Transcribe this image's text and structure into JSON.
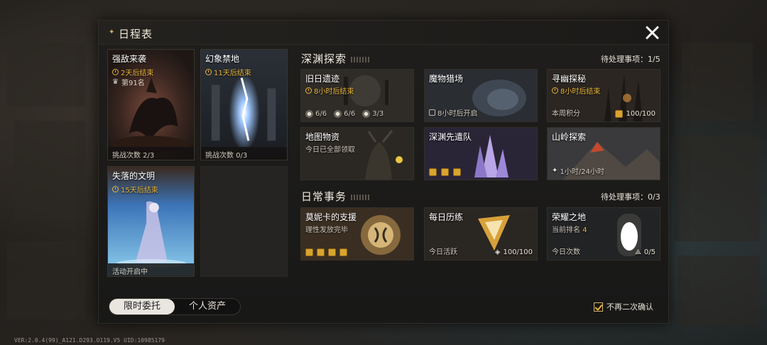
{
  "window": {
    "title": "日程表"
  },
  "left_cards": [
    {
      "title": "强敌来袭",
      "timer": "2天后结束",
      "rank": "第91名",
      "footer": "挑战次数 2/3"
    },
    {
      "title": "幻象禁地",
      "timer": "11天后结束",
      "footer": "挑战次数 0/3"
    },
    {
      "title": "失落的文明",
      "timer": "15天后结束",
      "footer": "活动开启中"
    }
  ],
  "abyss": {
    "title": "深渊探索",
    "pending": "待处理事项：1/5",
    "tiles": [
      {
        "title": "旧日遗迹",
        "timer": "8小时后结束",
        "stats": [
          "6/6",
          "6/6",
          "3/3"
        ]
      },
      {
        "title": "魔物猎场",
        "status": "8小时后开启"
      },
      {
        "title": "寻幽探秘",
        "timer": "8小时后结束",
        "label": "本周积分",
        "value": "100/100"
      },
      {
        "title": "地图物资",
        "sub": "今日已全部领取"
      },
      {
        "title": "深渊先遣队"
      },
      {
        "title": "山岭探索",
        "status": "1小时/24小时"
      }
    ]
  },
  "daily": {
    "title": "日常事务",
    "pending": "待处理事项：0/3",
    "tiles": [
      {
        "title": "莫妮卡的支援",
        "sub": "理性发放完毕"
      },
      {
        "title": "每日历练",
        "label": "今日活跃",
        "value": "100/100"
      },
      {
        "title": "荣耀之地",
        "sub_prefix": "当前排名",
        "sub_value": "4",
        "label": "今日次数",
        "value": "0/5"
      }
    ]
  },
  "tabs": {
    "active": "限时委托",
    "inactive": "个人资产"
  },
  "confirm_label": "不再二次确认",
  "version": "VER:2.0.4(99)_A121.D293.O119.V5   UID:10985179",
  "colors": {
    "accent": "#e8b53a",
    "panel": "#1f1e1c"
  }
}
